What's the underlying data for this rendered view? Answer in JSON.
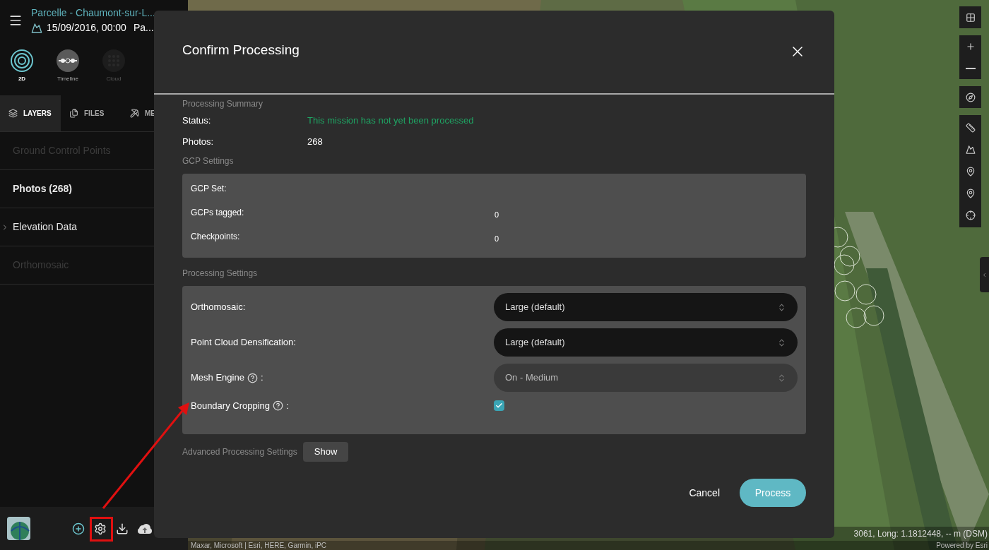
{
  "app": {
    "title": "Parcelle - Chaumont-sur-L...",
    "date": "15/09/2016, 00:00",
    "subtitle": "Pa..."
  },
  "views": [
    {
      "label": "2D",
      "selected": true,
      "disabled": false
    },
    {
      "label": "Timeline",
      "selected": false,
      "disabled": false
    },
    {
      "label": "Cloud",
      "selected": false,
      "disabled": true
    }
  ],
  "tabs": [
    {
      "label": "LAYERS",
      "selected": true
    },
    {
      "label": "FILES",
      "selected": false
    },
    {
      "label": "ME",
      "selected": false
    }
  ],
  "layers": [
    {
      "label": "Ground Control Points",
      "disabled": true,
      "emphasized": false,
      "expandable": false
    },
    {
      "label": "Photos (268)",
      "disabled": false,
      "emphasized": true,
      "expandable": false
    },
    {
      "label": "Elevation Data",
      "disabled": false,
      "emphasized": false,
      "expandable": true
    },
    {
      "label": "Orthomosaic",
      "disabled": true,
      "emphasized": false,
      "expandable": false
    }
  ],
  "dialog": {
    "title": "Confirm Processing",
    "summary": {
      "heading": "Processing Summary",
      "rows": [
        {
          "label": "Status:",
          "value": "This mission has not yet been processed",
          "color": "#1fa463"
        },
        {
          "label": "Photos:",
          "value": "268",
          "color": "#ffffff"
        }
      ]
    },
    "gcp": {
      "heading": "GCP Settings",
      "rows": [
        {
          "label": "GCP Set:"
        },
        {
          "label": "GCPs tagged:",
          "value": "0"
        },
        {
          "label": "Checkpoints:",
          "value": "0"
        }
      ]
    },
    "processing": {
      "heading": "Processing Settings",
      "rows": [
        {
          "kind": "select",
          "label": "Orthomosaic:",
          "help": false,
          "value": "Large (default)",
          "disabled": false
        },
        {
          "kind": "select",
          "label": "Point Cloud Densification:",
          "help": false,
          "value": "Large (default)",
          "disabled": false
        },
        {
          "kind": "select",
          "label": "Mesh Engine",
          "help": true,
          "suffix": ":",
          "value": "On - Medium",
          "disabled": true
        },
        {
          "kind": "checkbox",
          "label": "Boundary Cropping",
          "help": true,
          "suffix": ":",
          "checked": true
        }
      ]
    },
    "advanced": {
      "label": "Advanced Processing Settings",
      "button": "Show"
    },
    "buttons": {
      "cancel": "Cancel",
      "process": "Process"
    }
  },
  "map": {
    "coordinates": "3061, Long: 1.1812448, -- m (DSM)",
    "attribution": "Maxar, Microsoft | Esri, HERE, Garmin, iPC",
    "powered_by": "Powered by Esri"
  }
}
